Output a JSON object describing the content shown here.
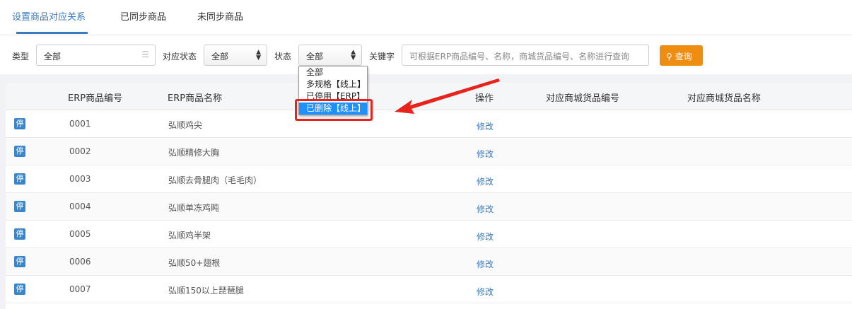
{
  "tabs": [
    {
      "label": "设置商品对应关系",
      "active": true
    },
    {
      "label": "已同步商品"
    },
    {
      "label": "未同步商品"
    }
  ],
  "filters": {
    "type_label": "类型",
    "type_value": "全部",
    "match_label": "对应状态",
    "match_value": "全部",
    "status_label": "状态",
    "status_value": "全部",
    "keyword_label": "关键字",
    "keyword_placeholder": "可根据ERP商品编号、名称，商城货品编号、名称进行查询",
    "search_label": "查询"
  },
  "status_options": [
    "全部",
    "多规格【线上】",
    "已停用【ERP】",
    "已删除【线上】"
  ],
  "table": {
    "headers": [
      "ERP商品编号",
      "ERP商品名称",
      "操作",
      "对应商城货品编号",
      "对应商城货品名称"
    ],
    "rows": [
      {
        "tag": "停",
        "code": "0001",
        "name": "弘顺鸡尖",
        "action": "修改"
      },
      {
        "tag": "停",
        "code": "0002",
        "name": "弘顺精修大胸",
        "action": "修改"
      },
      {
        "tag": "停",
        "code": "0003",
        "name": "弘顺去骨腿肉（毛毛肉）",
        "action": "修改"
      },
      {
        "tag": "停",
        "code": "0004",
        "name": "弘顺单冻鸡盹",
        "action": "修改"
      },
      {
        "tag": "停",
        "code": "0005",
        "name": "弘顺鸡半架",
        "action": "修改"
      },
      {
        "tag": "停",
        "code": "0006",
        "name": "弘顺50+翅根",
        "action": "修改"
      },
      {
        "tag": "停",
        "code": "0007",
        "name": "弘顺150以上琵琶腿",
        "action": "修改"
      }
    ]
  },
  "colors": {
    "accent": "#3a7bbf",
    "button": "#ee8d0f",
    "highlight": "#1e90ff",
    "annotation": "#e8231c"
  }
}
